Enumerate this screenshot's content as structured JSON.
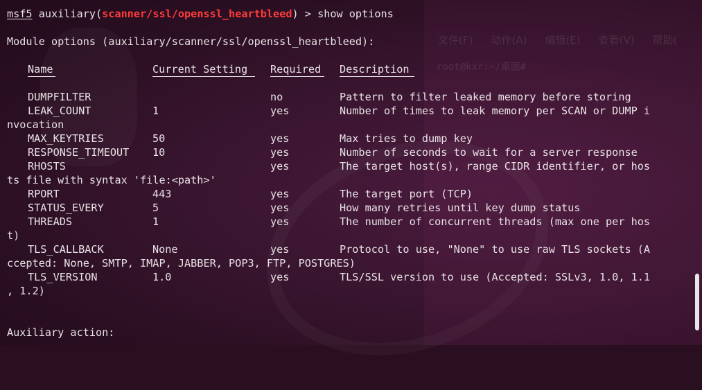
{
  "prompt": {
    "prefix": "msf5",
    "module_word": "auxiliary(",
    "module_path": "scanner/ssl/openssl_heartbleed",
    "close": ")",
    "suffix": " > show options"
  },
  "module_options_title": "Module options (auxiliary/scanner/ssl/openssl_heartbleed):",
  "columns": {
    "name": "Name",
    "current": "Current Setting",
    "required": "Required",
    "description": "Description"
  },
  "options": [
    {
      "name": "DUMPFILTER",
      "current": "",
      "required": "no",
      "description": "Pattern to filter leaked memory before storing",
      "wrap": ""
    },
    {
      "name": "LEAK_COUNT",
      "current": "1",
      "required": "yes",
      "description": "Number of times to leak memory per SCAN or DUMP i",
      "wrap": "nvocation"
    },
    {
      "name": "MAX_KEYTRIES",
      "current": "50",
      "required": "yes",
      "description": "Max tries to dump key",
      "wrap": ""
    },
    {
      "name": "RESPONSE_TIMEOUT",
      "current": "10",
      "required": "yes",
      "description": "Number of seconds to wait for a server response",
      "wrap": ""
    },
    {
      "name": "RHOSTS",
      "current": "",
      "required": "yes",
      "description": "The target host(s), range CIDR identifier, or hos",
      "wrap": "ts file with syntax 'file:<path>'"
    },
    {
      "name": "RPORT",
      "current": "443",
      "required": "yes",
      "description": "The target port (TCP)",
      "wrap": ""
    },
    {
      "name": "STATUS_EVERY",
      "current": "5",
      "required": "yes",
      "description": "How many retries until key dump status",
      "wrap": ""
    },
    {
      "name": "THREADS",
      "current": "1",
      "required": "yes",
      "description": "The number of concurrent threads (max one per hos",
      "wrap": "t)"
    },
    {
      "name": "TLS_CALLBACK",
      "current": "None",
      "required": "yes",
      "description": "Protocol to use, \"None\" to use raw TLS sockets (A",
      "wrap": "ccepted: None, SMTP, IMAP, JABBER, POP3, FTP, POSTGRES)"
    },
    {
      "name": "TLS_VERSION",
      "current": "1.0",
      "required": "yes",
      "description": "TLS/SSL version to use (Accepted: SSLv3, 1.0, 1.1",
      "wrap": ", 1.2)"
    }
  ],
  "auxiliary_action_title": "Auxiliary action:",
  "background_window": {
    "menu": [
      "文件(F)",
      "动作(A)",
      "编辑(E)",
      "查看(V)",
      "帮助("
    ],
    "prompt": "root@kxr:~/桌面# "
  }
}
